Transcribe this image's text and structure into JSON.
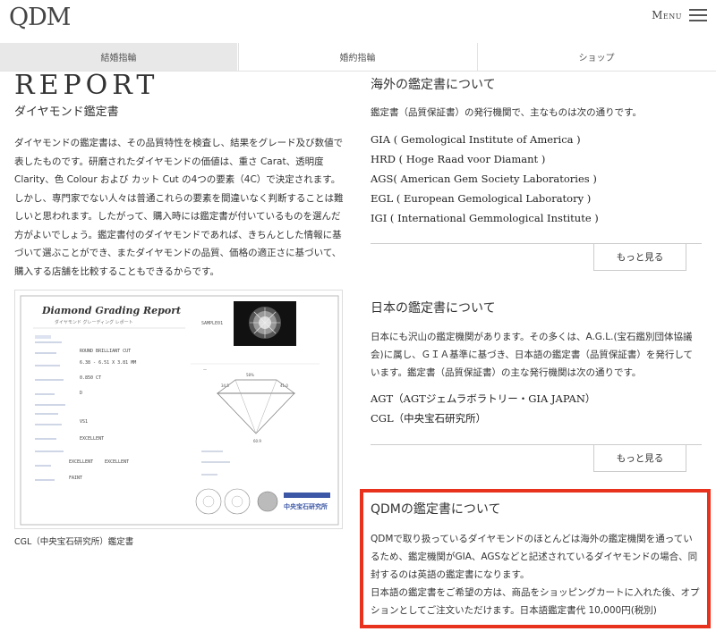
{
  "header": {
    "logo": "QDM",
    "menu_label": "Menu",
    "menu_icon": "hamburger-icon"
  },
  "tabs": [
    {
      "label": "結婚指輪"
    },
    {
      "label": "婚約指輪"
    },
    {
      "label": "ショップ"
    }
  ],
  "report": {
    "title": "REPORT",
    "subtitle": "ダイヤモンド鑑定書",
    "body": [
      "ダイヤモンドの鑑定書は、その品質特性を検査し、結果をグレード及び数値で表したものです。研磨されたダイヤモンドの価値は、重さ Carat、透明度 Clarity、色 Colour および カット Cut の4つの要素（4C）で決定されます。",
      "しかし、専門家でない人々は普通これらの要素を間違いなく判断することは難しいと思われます。したがって、購入時には鑑定書が付いているものを選んだ方がよいでしょう。鑑定書付のダイヤモンドであれば、きちんとした情報に基づいて選ぶことができ、またダイヤモンドの品質、価格の適正さに基づいて、購入する店舗を比較することもできるからです。"
    ],
    "certificate": {
      "heading": "Diamond Grading Report",
      "subheading": "ダイヤモンド グレーディング レポート",
      "sample": "SAMPLE01",
      "fields": [
        "ROUND BRILLIANT CUT",
        "6.38 - 6.51 X 3.81 MM",
        "0.850 CT",
        "D",
        "VS1",
        "EXCELLENT",
        "EXCELLENT",
        "EXCELLENT",
        "FAINT"
      ],
      "lab_name": "中央宝石研究所"
    },
    "caption": "CGL（中央宝石研究所）鑑定書"
  },
  "overseas": {
    "title": "海外の鑑定書について",
    "intro": "鑑定書（品質保証書）の発行機関で、主なものは次の通りです。",
    "orgs": [
      "GIA ( Gemological Institute of America )",
      "HRD ( Hoge Raad voor Diamant )",
      "AGS( American Gem Society Laboratories )",
      "EGL ( European Gemological Laboratory )",
      "IGI ( International Gemmological Institute )"
    ],
    "more": "もっと見る"
  },
  "japan": {
    "title": "日本の鑑定書について",
    "intro": "日本にも沢山の鑑定機関があります。その多くは、A.G.L.(宝石鑑別団体協議会)に属し、ＧＩＡ基準に基づき、日本語の鑑定書（品質保証書）を発行しています。鑑定書（品質保証書）の主な発行機関は次の通りです。",
    "orgs": [
      "AGT（AGTジェムラボラトリー・GIA JAPAN）",
      "CGL（中央宝石研究所）"
    ],
    "more": "もっと見る"
  },
  "qdm": {
    "title": "QDMの鑑定書について",
    "body1": "QDMで取り扱っているダイヤモンドのほとんどは海外の鑑定機関を通っているため、鑑定機関がGIA、AGSなどと記述されているダイヤモンドの場合、同封するのは英語の鑑定書になります。",
    "body2": "日本語の鑑定書をご希望の方は、商品をショッピングカートに入れた後、オプションとしてご注文いただけます。日本語鑑定書代 10,000円(税別)",
    "highlight_color": "#e8321e"
  }
}
